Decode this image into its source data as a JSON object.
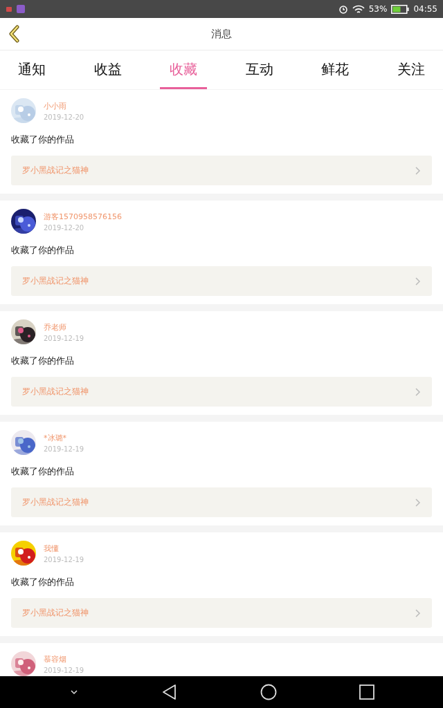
{
  "status_bar": {
    "battery": "53%",
    "time": "04:55"
  },
  "header": {
    "title": "消息"
  },
  "tabs": [
    {
      "label": "通知",
      "selected": false
    },
    {
      "label": "收益",
      "selected": false
    },
    {
      "label": "收藏",
      "selected": true
    },
    {
      "label": "互动",
      "selected": false
    },
    {
      "label": "鲜花",
      "selected": false
    },
    {
      "label": "关注",
      "selected": false
    }
  ],
  "messages": [
    {
      "name": "小小雨",
      "date": "2019-12-20",
      "action": "收藏了你的作品",
      "work": "罗小黑战记之猫神"
    },
    {
      "name": "游客1570958576156",
      "date": "2019-12-20",
      "action": "收藏了你的作品",
      "work": "罗小黑战记之猫神"
    },
    {
      "name": "乔老师",
      "date": "2019-12-19",
      "action": "收藏了你的作品",
      "work": "罗小黑战记之猫神"
    },
    {
      "name": "*冰璐*",
      "date": "2019-12-19",
      "action": "收藏了你的作品",
      "work": "罗小黑战记之猫神"
    },
    {
      "name": "我懂",
      "date": "2019-12-19",
      "action": "收藏了你的作品",
      "work": "罗小黑战记之猫神"
    },
    {
      "name": "慕容烟",
      "date": "2019-12-19"
    }
  ]
}
